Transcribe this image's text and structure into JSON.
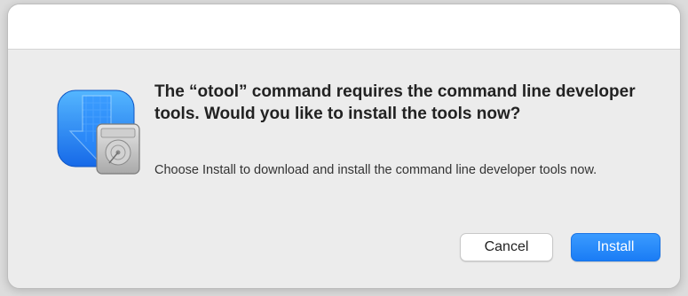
{
  "dialog": {
    "title": "The “otool” command requires the command line developer tools. Would you like to install the tools now?",
    "message": "Choose Install to download and install the command line developer tools now.",
    "icon": "developer-tools-installer-icon",
    "buttons": {
      "cancel_label": "Cancel",
      "install_label": "Install"
    },
    "colors": {
      "accent": "#1a7cf5",
      "background": "#ececec",
      "titlebar": "#ffffff"
    }
  }
}
